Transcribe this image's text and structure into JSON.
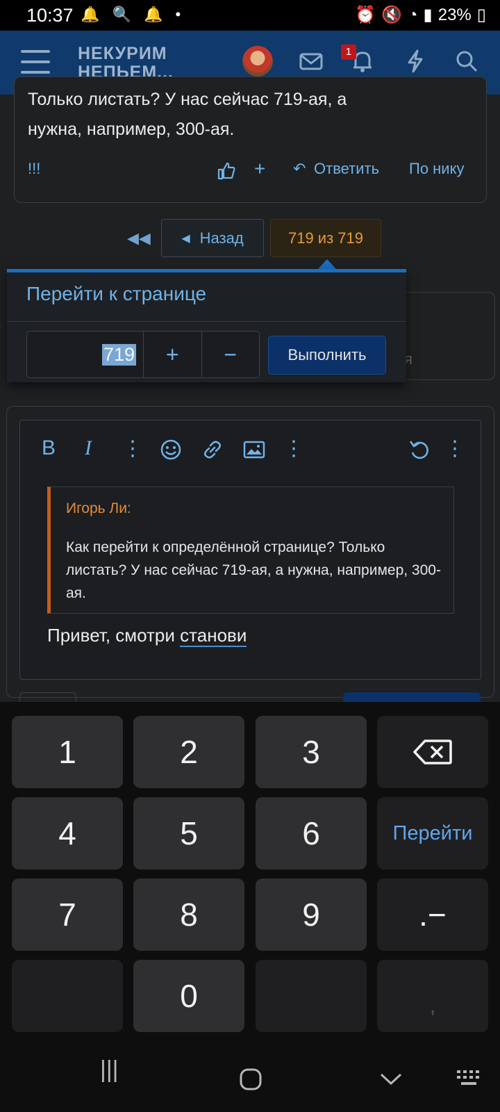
{
  "status_bar": {
    "time": "10:37",
    "battery": "23%"
  },
  "header": {
    "logo_line1": "НЕКУРИМ",
    "logo_line2": "НЕПЬЕМ...",
    "notification_count": "1"
  },
  "post": {
    "text_line1": "Только листать? У нас сейчас 719-ая, а",
    "text_line2": "нужна, например, 300-ая.",
    "flag": "!!!",
    "reply_label": "Ответить",
    "by_nick_label": "По нику"
  },
  "pagination": {
    "back_label": "Назад",
    "current_label": "719 из 719"
  },
  "background_fragment": "я",
  "jump_popup": {
    "title": "Перейти к странице",
    "page_value": "719",
    "plus": "+",
    "minus": "−",
    "go_label": "Выполнить"
  },
  "editor": {
    "bold": "B",
    "italic": "I",
    "quote_author": "Игорь Ли:",
    "quote_text": "Как перейти к определённой странице? Только листать? У нас сейчас 719-ая, а нужна, например, 300-ая.",
    "reply_text_prefix": "Привет, смотри ",
    "reply_text_word": "станови"
  },
  "keyboard": {
    "keys": [
      "1",
      "2",
      "3",
      "4",
      "5",
      "6",
      "7",
      "8",
      "9",
      "0"
    ],
    "go_label": "Перейти",
    "symbols": ".−",
    "comma": ","
  }
}
